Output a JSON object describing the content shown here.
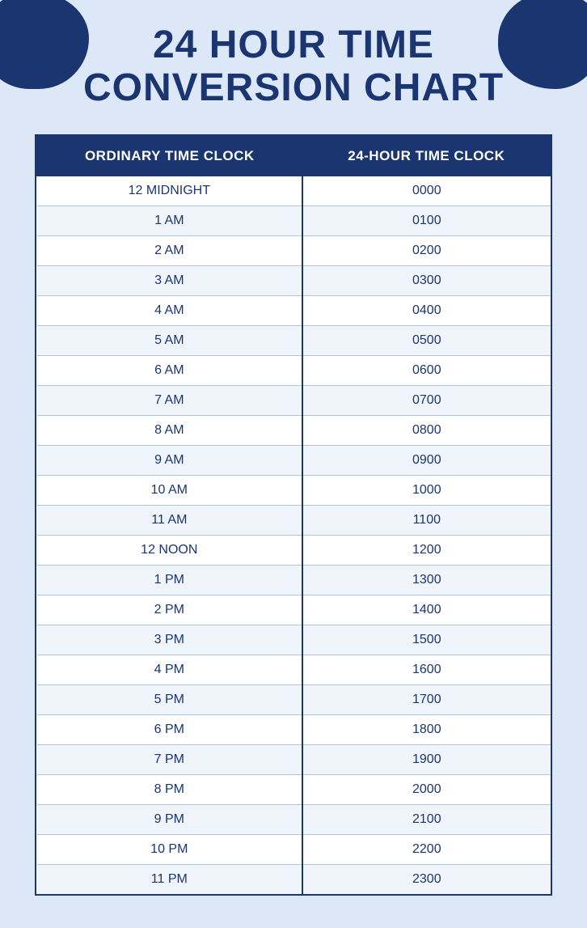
{
  "page": {
    "background_color": "#dce8f8",
    "title_line1": "24 HOUR TIME",
    "title_line2": "CONVERSION CHART"
  },
  "table": {
    "headers": [
      "ORDINARY TIME CLOCK",
      "24-HOUR TIME CLOCK"
    ],
    "rows": [
      {
        "ordinary": "12 MIDNIGHT",
        "military": "0000"
      },
      {
        "ordinary": "1 AM",
        "military": "0100"
      },
      {
        "ordinary": "2 AM",
        "military": "0200"
      },
      {
        "ordinary": "3 AM",
        "military": "0300"
      },
      {
        "ordinary": "4 AM",
        "military": "0400"
      },
      {
        "ordinary": "5 AM",
        "military": "0500"
      },
      {
        "ordinary": "6 AM",
        "military": "0600"
      },
      {
        "ordinary": "7 AM",
        "military": "0700"
      },
      {
        "ordinary": "8 AM",
        "military": "0800"
      },
      {
        "ordinary": "9 AM",
        "military": "0900"
      },
      {
        "ordinary": "10 AM",
        "military": "1000"
      },
      {
        "ordinary": "11 AM",
        "military": "1100"
      },
      {
        "ordinary": "12 NOON",
        "military": "1200"
      },
      {
        "ordinary": "1 PM",
        "military": "1300"
      },
      {
        "ordinary": "2 PM",
        "military": "1400"
      },
      {
        "ordinary": "3 PM",
        "military": "1500"
      },
      {
        "ordinary": "4 PM",
        "military": "1600"
      },
      {
        "ordinary": "5 PM",
        "military": "1700"
      },
      {
        "ordinary": "6 PM",
        "military": "1800"
      },
      {
        "ordinary": "7 PM",
        "military": "1900"
      },
      {
        "ordinary": "8 PM",
        "military": "2000"
      },
      {
        "ordinary": "9 PM",
        "military": "2100"
      },
      {
        "ordinary": "10 PM",
        "military": "2200"
      },
      {
        "ordinary": "11 PM",
        "military": "2300"
      }
    ]
  }
}
